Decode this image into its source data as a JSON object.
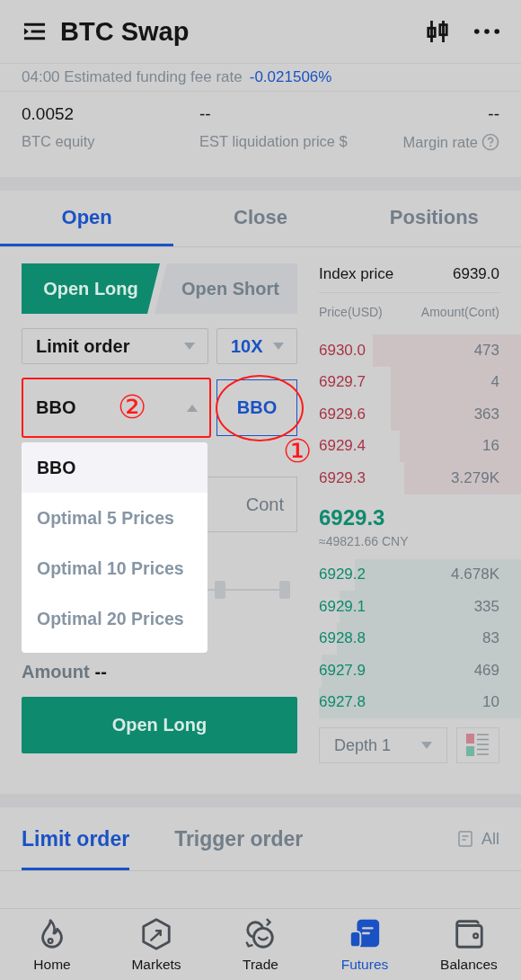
{
  "header": {
    "title": "BTC Swap"
  },
  "funding": {
    "label": "04:00 Estimated funding fee rate",
    "value": "-0.021506%"
  },
  "stats": [
    {
      "value": "0.0052",
      "label": "BTC equity"
    },
    {
      "value": "--",
      "label": "EST liquidation price $"
    },
    {
      "value": "--",
      "label": "Margin rate",
      "help": true
    }
  ],
  "tabs": [
    {
      "label": "Open",
      "selected": true
    },
    {
      "label": "Close",
      "selected": false
    },
    {
      "label": "Positions",
      "selected": false
    }
  ],
  "side_toggle": [
    {
      "label": "Open Long",
      "selected": true
    },
    {
      "label": "Open Short",
      "selected": false
    }
  ],
  "order_type": {
    "value": "Limit order"
  },
  "leverage": {
    "value": "10X"
  },
  "price_type": {
    "value": "BBO",
    "expanded": true
  },
  "bbo_button": {
    "label": "BBO"
  },
  "price_menu": [
    {
      "label": "BBO",
      "selected": true
    },
    {
      "label": "Optimal 5 Prices",
      "selected": false
    },
    {
      "label": "Optimal 10 Prices",
      "selected": false
    },
    {
      "label": "Optimal 20 Prices",
      "selected": false
    }
  ],
  "amount_field": {
    "unit": "Cont"
  },
  "annotations": {
    "select_mark": "②",
    "button_mark": "①"
  },
  "amount": {
    "label": "Amount",
    "value": "--"
  },
  "submit": {
    "label": "Open Long"
  },
  "order_book": {
    "index_label": "Index price",
    "index_value": "6939.0",
    "columns": [
      "Price(USD)",
      "Amount(Cont)"
    ],
    "asks": [
      {
        "price": "6930.0",
        "amount": "473"
      },
      {
        "price": "6929.7",
        "amount": "4"
      },
      {
        "price": "6929.6",
        "amount": "363"
      },
      {
        "price": "6929.4",
        "amount": "16"
      },
      {
        "price": "6929.3",
        "amount": "3.279K"
      }
    ],
    "last_price": "6929.3",
    "last_price_cny": "≈49821.66 CNY",
    "bids": [
      {
        "price": "6929.2",
        "amount": "4.678K"
      },
      {
        "price": "6929.1",
        "amount": "335"
      },
      {
        "price": "6928.8",
        "amount": "83"
      },
      {
        "price": "6927.9",
        "amount": "469"
      },
      {
        "price": "6927.8",
        "amount": "10"
      }
    ],
    "depth": "Depth 1"
  },
  "order_tabs": [
    {
      "label": "Limit order",
      "selected": true
    },
    {
      "label": "Trigger order",
      "selected": false
    }
  ],
  "all_link": "All",
  "nav": [
    {
      "label": "Home",
      "kind": "home",
      "selected": false
    },
    {
      "label": "Markets",
      "kind": "markets",
      "selected": false
    },
    {
      "label": "Trade",
      "kind": "trade",
      "selected": false
    },
    {
      "label": "Futures",
      "kind": "futures",
      "selected": true
    },
    {
      "label": "Balances",
      "kind": "balances",
      "selected": false
    }
  ]
}
